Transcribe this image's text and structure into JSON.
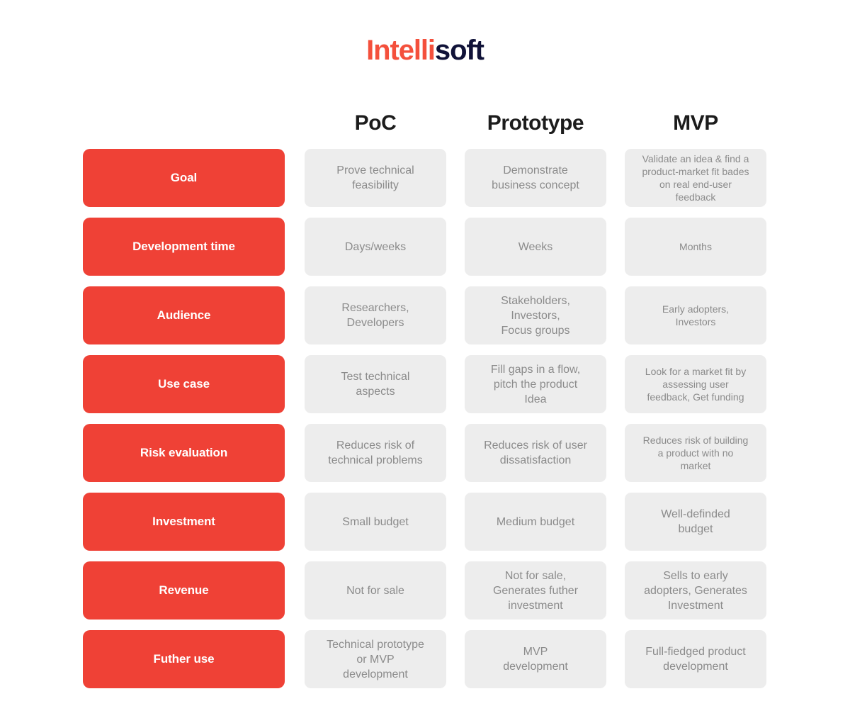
{
  "logo": {
    "part_a": "Intelli",
    "part_b": "soft",
    "color_a": "#F4503C",
    "color_b": "#101238"
  },
  "theme": {
    "accent_red": "#EF4136",
    "cell_gray": "#EDEDED",
    "cell_text": "#8b8b8b",
    "header_text": "#1c1c1c",
    "page_background": "#FFFFFF"
  },
  "table": {
    "row_header_label": "",
    "columns": [
      "PoC",
      "Prototype",
      "MVP"
    ],
    "rows": [
      {
        "label": "Goal",
        "poc": "Prove technical\nfeasibility",
        "prototype": "Demonstrate\nbusiness concept",
        "mvp": "Validate an idea & find a\nproduct-market fit bades\non real end-user\nfeedback"
      },
      {
        "label": "Development time",
        "poc": "Days/weeks",
        "prototype": "Weeks",
        "mvp": "Months"
      },
      {
        "label": "Audience",
        "poc": "Researchers,\nDevelopers",
        "prototype": "Stakeholders,\nInvestors,\nFocus groups",
        "mvp": "Early adopters,\nInvestors"
      },
      {
        "label": "Use case",
        "poc": "Test technical\naspects",
        "prototype": "Fill gaps in a flow,\npitch the product\nIdea",
        "mvp": "Look for a market fit by\nassessing user\nfeedback, Get funding"
      },
      {
        "label": "Risk evaluation",
        "poc": "Reduces risk of\ntechnical problems",
        "prototype": "Reduces risk of user\ndissatisfaction",
        "mvp": "Reduces risk of building\na product with no\nmarket"
      },
      {
        "label": "Investment",
        "poc": "Small budget",
        "prototype": "Medium budget",
        "mvp": "Well-definded\nbudget"
      },
      {
        "label": "Revenue",
        "poc": "Not for sale",
        "prototype": "Not for sale,\nGenerates futher\ninvestment",
        "mvp": "Sells to early\nadopters, Generates\nInvestment"
      },
      {
        "label": "Futher use",
        "poc": "Technical prototype\nor MVP\ndevelopment",
        "prototype": "MVP\ndevelopment",
        "mvp": "Full-fiedged product\ndevelopment"
      }
    ]
  }
}
